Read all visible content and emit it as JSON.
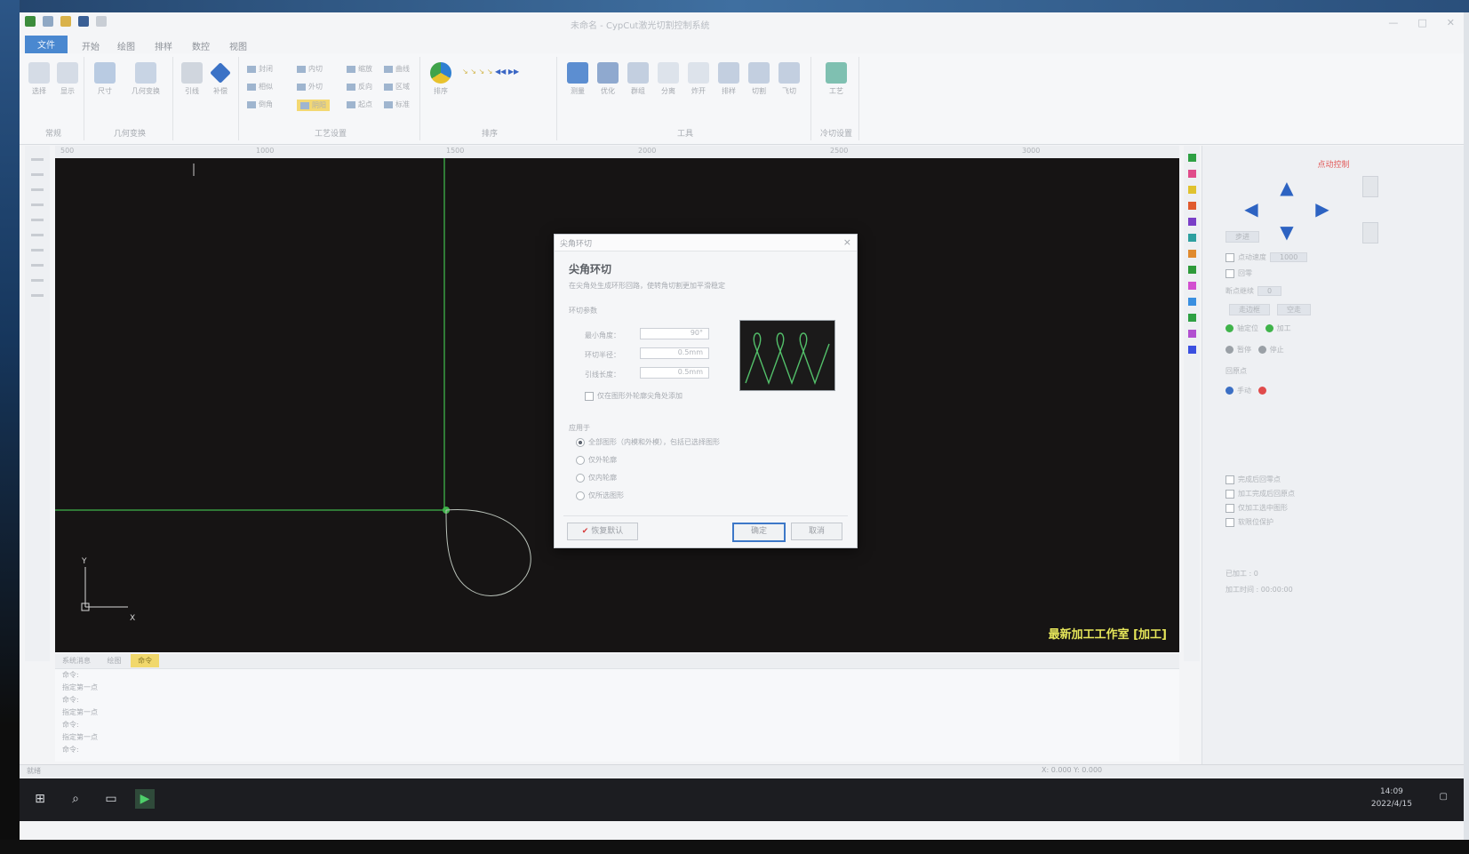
{
  "window": {
    "title": "未命名 - CypCut激光切割控制系统"
  },
  "menu": {
    "items": [
      "文件",
      "开始",
      "绘图",
      "排样",
      "数控",
      "视图"
    ]
  },
  "ribbon": {
    "groups": [
      {
        "label": "常规",
        "buttons": [
          "选择",
          "显示"
        ]
      },
      {
        "label": "几何变换",
        "buttons": [
          "尺寸",
          "几何变换"
        ]
      },
      {
        "label": "",
        "buttons": [
          "引线",
          "补偿"
        ]
      },
      {
        "label": "工艺设置",
        "buttons": [
          "冷却点",
          "微连",
          "阵列"
        ]
      },
      {
        "label": "排序",
        "buttons": [
          "排序"
        ]
      },
      {
        "label": "工具",
        "buttons": [
          "测量",
          "优化",
          "群组",
          "分离",
          "炸开",
          "排样",
          "切割",
          "飞切"
        ]
      },
      {
        "label": "冷切设置",
        "buttons": [
          "工艺"
        ]
      }
    ],
    "small_items": [
      "封闭",
      "相似",
      "倒角",
      "内切",
      "外切",
      "阴阳",
      "缩放",
      "反向",
      "起点",
      "曲线",
      "区域",
      "标准"
    ]
  },
  "ruler": {
    "marks": [
      "500",
      "1000",
      "1500",
      "2000",
      "2500",
      "3000"
    ]
  },
  "canvas": {
    "status": "最新加工工作室 [加工]",
    "axis_x": "X",
    "axis_y": "Y"
  },
  "dialog": {
    "title": "尖角环切",
    "close": "×",
    "heading": "尖角环切",
    "description": "在尖角处生成环形回路，使转角切割更加平滑稳定",
    "group_label": "环切参数",
    "fields": [
      {
        "label": "最小角度：",
        "value": "90°"
      },
      {
        "label": "环切半径：",
        "value": "0.5mm"
      },
      {
        "label": "引线长度：",
        "value": "0.5mm"
      }
    ],
    "checkbox": "仅在图形外轮廓尖角处添加",
    "apply_group": "应用于",
    "radios": [
      {
        "label": "全部图形（内模和外模），包括已选择图形",
        "checked": true
      },
      {
        "label": "仅外轮廓",
        "checked": false
      },
      {
        "label": "仅内轮廓",
        "checked": false
      },
      {
        "label": "仅所选图形",
        "checked": false
      }
    ],
    "buttons": {
      "reset": "恢复默认",
      "ok": "确定",
      "cancel": "取消"
    }
  },
  "right_panel": {
    "title": "点动控制",
    "rows": [
      "步进",
      "点动速度",
      "回零",
      "断点继续",
      "走边框",
      "空走",
      "轴定位",
      "加工",
      "暂停",
      "停止",
      "回原点",
      "手动"
    ],
    "options": [
      "完成后回零点",
      "加工完成后回原点",
      "仅加工选中图形",
      "软限位保护"
    ],
    "counts": {
      "parts_label": "已加工",
      "parts_value": "0",
      "time_label": "加工时间",
      "time_value": "00:00:00"
    }
  },
  "palette_colors": [
    "#2ea043",
    "#e04b8a",
    "#e0c22e",
    "#e05a2e",
    "#7a3fc7",
    "#2ea0a0",
    "#e08a2e",
    "#2e9a3a",
    "#d24fd0",
    "#3a8fe0",
    "#2ea043",
    "#b14fd0",
    "#3a4fe0"
  ],
  "command_panel": {
    "tabs": [
      "系统消息",
      "绘图",
      "命令"
    ],
    "lines": [
      "命令:",
      "指定第一点",
      "命令:",
      "指定第一点",
      "命令:",
      "指定第一点",
      "命令:"
    ]
  },
  "statusbar": {
    "left": "就绪",
    "right": "X: 0.000  Y: 0.000"
  },
  "taskbar": {
    "time": "14:09",
    "date": "2022/4/15"
  },
  "colors": {
    "canvas_bg": "#161414",
    "accent": "#4a88d0",
    "geometry_green": "#3fb34a",
    "status_yellow": "#e6e65a"
  }
}
